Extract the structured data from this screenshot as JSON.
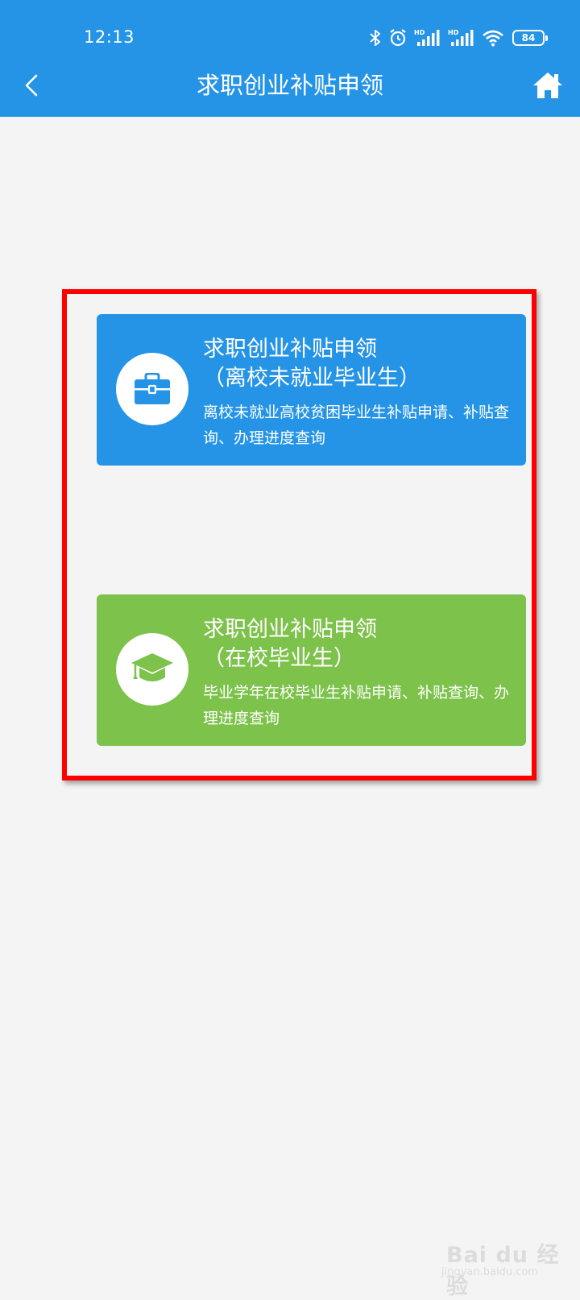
{
  "status_bar": {
    "time": "12:13",
    "battery": "84",
    "icons": [
      "bluetooth-icon",
      "alarm-icon",
      "signal-hd-icon",
      "signal-hd-icon",
      "wifi-icon",
      "battery-icon"
    ]
  },
  "header": {
    "title": "求职创业补贴申领",
    "back_icon": "chevron-left-icon",
    "home_icon": "home-icon"
  },
  "cards": [
    {
      "icon": "briefcase-icon",
      "title_line1": "求职创业补贴申领",
      "title_line2": "（离校未就业毕业生）",
      "subtitle": "离校未就业高校贫困毕业生补贴申请、补贴查询、办理进度查询",
      "color": "#2694e6"
    },
    {
      "icon": "graduation-cap-icon",
      "title_line1": "求职创业补贴申领",
      "title_line2": "（在校毕业生）",
      "subtitle": "毕业学年在校毕业生补贴申请、补贴查询、办理进度查询",
      "color": "#7dc24b"
    }
  ],
  "highlight_color": "#ff0000",
  "watermark": {
    "brand": "Bai du 经验",
    "url": "jingyan.baidu.com"
  }
}
